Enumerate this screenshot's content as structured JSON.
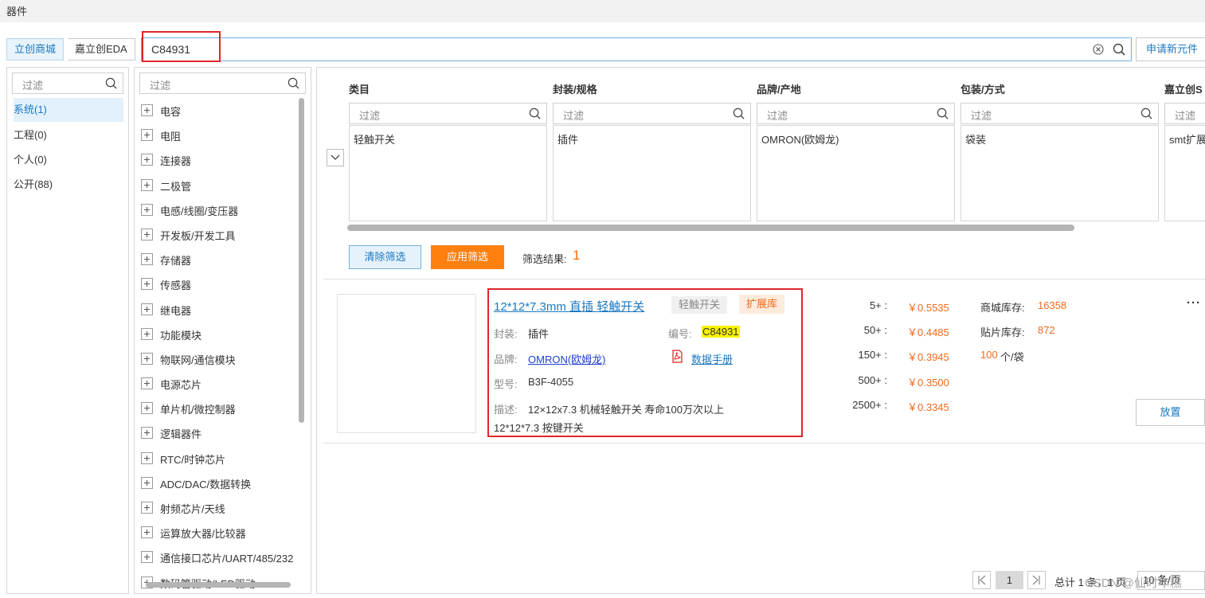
{
  "window": {
    "title": "器件"
  },
  "source_tabs": [
    "立创商城",
    "嘉立创EDA"
  ],
  "search": {
    "value": "C84931"
  },
  "apply_new_label": "申请新元件",
  "filter_placeholder": "过滤",
  "libraries": [
    "系统(1)",
    "工程(0)",
    "个人(0)",
    "公开(88)"
  ],
  "categories": [
    "电容",
    "电阻",
    "连接器",
    "二极管",
    "电感/线圈/变压器",
    "开发板/开发工具",
    "存储器",
    "传感器",
    "继电器",
    "功能模块",
    "物联网/通信模块",
    "电源芯片",
    "单片机/微控制器",
    "逻辑器件",
    "RTC/时钟芯片",
    "ADC/DAC/数据转换",
    "射频芯片/天线",
    "运算放大器/比较器",
    "通信接口芯片/UART/485/232",
    "数码管驱动/LED驱动"
  ],
  "filter_columns": [
    {
      "header": "类目",
      "value": "轻触开关"
    },
    {
      "header": "封装/规格",
      "value": "插件"
    },
    {
      "header": "品牌/产地",
      "value": "OMRON(欧姆龙)"
    },
    {
      "header": "包装/方式",
      "value": "袋装"
    },
    {
      "header": "嘉立创S",
      "value": "smt扩展"
    }
  ],
  "actions": {
    "clear": "清除筛选",
    "apply": "应用筛选",
    "result_label": "筛选结果:",
    "result_count": "1"
  },
  "product": {
    "title": "12*12*7.3mm 直插 轻触开关",
    "category_tag": "轻触开关",
    "library_tag": "扩展库",
    "package_label": "封装:",
    "package": "插件",
    "code_label": "编号:",
    "code": "C84931",
    "brand_label": "品牌:",
    "brand": "OMRON(欧姆龙)",
    "datasheet": "数据手册",
    "model_label": "型号:",
    "model": "B3F-4055",
    "desc_label": "描述:",
    "desc_line1": "12×12x7.3 机械轻触开关 寿命100万次以上",
    "desc_line2": "12*12*7.3 按键开关",
    "prices": [
      {
        "qty": "5+ :",
        "price": "￥0.5535"
      },
      {
        "qty": "50+ :",
        "price": "￥0.4485"
      },
      {
        "qty": "150+ :",
        "price": "￥0.3945"
      },
      {
        "qty": "500+ :",
        "price": "￥0.3500"
      },
      {
        "qty": "2500+ :",
        "price": "￥0.3345"
      }
    ],
    "mall_stock_label": "商城库存:",
    "mall_stock": "16358",
    "smt_stock_label": "贴片库存:",
    "smt_stock": "872",
    "pack_count": "100",
    "pack_unit": "个/袋",
    "more": "···",
    "place": "放置"
  },
  "pagination": {
    "page": "1",
    "info": "总计 1 条，1 页",
    "page_size": "10 条/页"
  },
  "watermark": "CSDN @仙时年糕",
  "colors": {
    "accent": "#1a78c2",
    "orange": "#ff7f0f",
    "highlight_red": "#e0262c",
    "code_highlight": "#f7f200"
  }
}
